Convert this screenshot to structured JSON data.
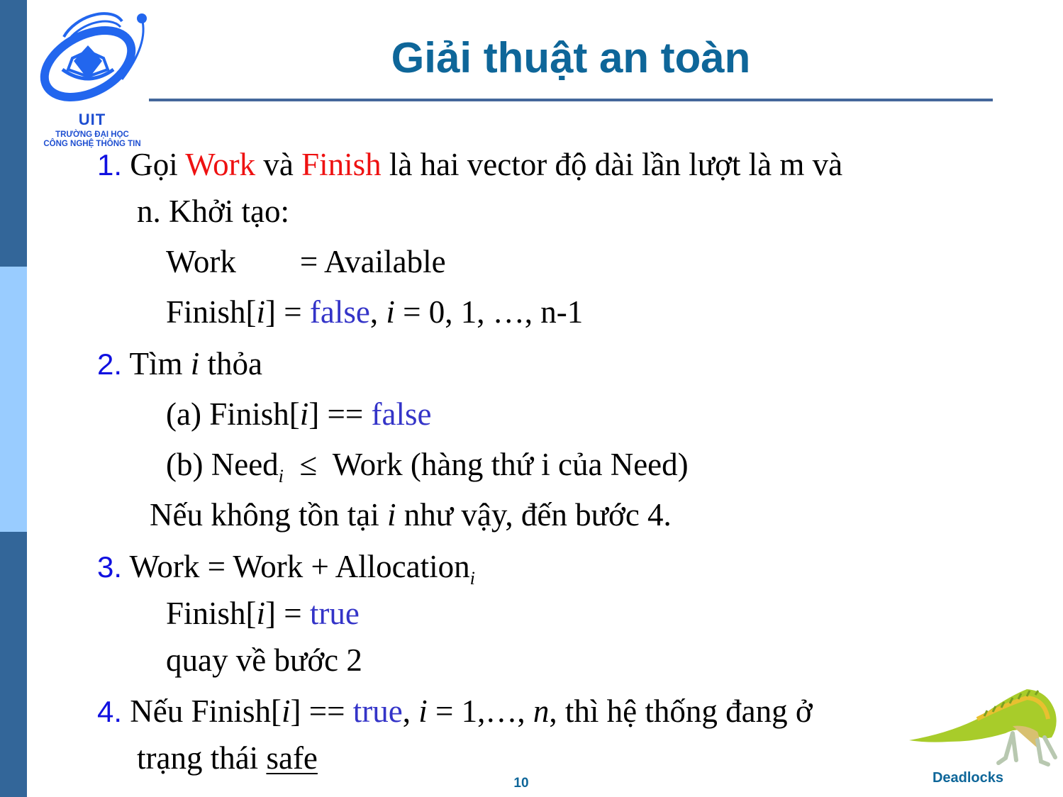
{
  "slide": {
    "title": "Giải thuật an toàn",
    "page_number": "10",
    "footer_label": "Deadlocks"
  },
  "logo": {
    "name": "UIT",
    "line1": "TRƯỜNG ĐẠI HỌC",
    "line2": "CÔNG NGHỆ THÔNG TIN"
  },
  "colors": {
    "title": "#0e6699",
    "step_number": "#1010e0",
    "highlight_red": "#ee1111",
    "keyword_blue": "#3434c8",
    "sidebar_dark": "#336699",
    "sidebar_light": "#99ccff"
  },
  "steps": {
    "s1": {
      "num": "1.",
      "a": " Gọi ",
      "work": "Work",
      "b": " và ",
      "finish": "Finish",
      "c": " là hai vector độ dài lần lượt là m và",
      "cont": "n. Khởi tạo:",
      "work_line_lhs": "Work",
      "work_line_rhs": "= Available",
      "finish_line_a": "Finish[",
      "finish_line_i": "i",
      "finish_line_b": "] = ",
      "finish_line_false": "false",
      "finish_line_c": ", ",
      "finish_line_i2": "i",
      "finish_line_d": " = 0, 1, …, n-1"
    },
    "s2": {
      "num": "2.",
      "a": " Tìm ",
      "i": "i",
      "b": " thỏa",
      "cond_a_1": "(a) Finish[",
      "cond_a_i": "i",
      "cond_a_2": "] == ",
      "cond_a_false": "false",
      "cond_b_1": "(b) Need",
      "cond_b_sub": "i",
      "cond_b_2": "  ≤  Work (hàng thứ i của Need)",
      "else_1": "Nếu không tồn tại ",
      "else_i": "i",
      "else_2": " như vậy, đến bước 4."
    },
    "s3": {
      "num": "3.",
      "a": " Work = Work + Allocation",
      "sub": "i",
      "finish_1": "Finish[",
      "finish_i": "i",
      "finish_2": "] = ",
      "finish_true": "true",
      "goto": "quay về bước 2"
    },
    "s4": {
      "num": "4.",
      "a": " Nếu Finish[",
      "i": "i",
      "b": "] == ",
      "true": "true",
      "c": ", ",
      "i2": "i",
      "d": " = 1,…, ",
      "n": "n",
      "e": ", thì hệ thống đang ở",
      "cont_1": "trạng thái ",
      "cont_safe": "safe"
    }
  }
}
